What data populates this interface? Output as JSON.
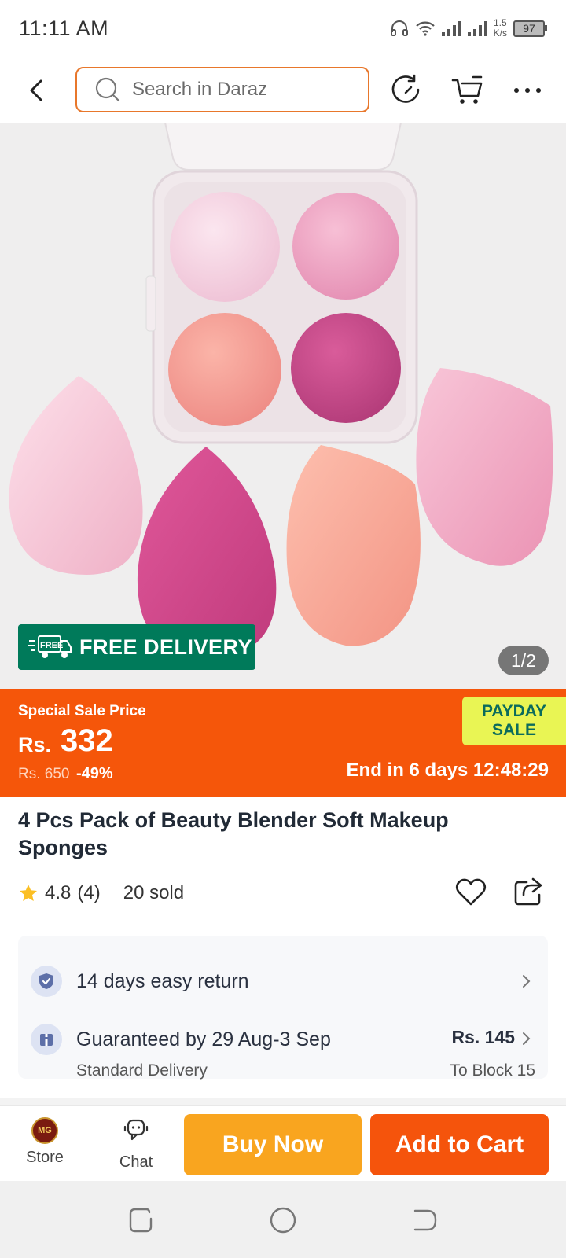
{
  "status_bar": {
    "time": "11:11 AM",
    "net_speed_value": "1.5",
    "net_speed_unit": "K/s",
    "battery": "97"
  },
  "header": {
    "search_placeholder": "Search in Daraz"
  },
  "gallery": {
    "free_delivery_label": "FREE DELIVERY",
    "free_truck_text": "FREE",
    "counter": "1/2"
  },
  "sale": {
    "label": "Special Sale Price",
    "currency": "Rs.",
    "price": "332",
    "original_price": "Rs. 650",
    "discount": "-49%",
    "campaign_line1": "PAYDAY",
    "campaign_line2": "SALE",
    "countdown": "End in 6 days 12:48:29",
    "colors": {
      "banner": "#f5560a",
      "campaign_bg": "#e9f554",
      "campaign_text": "#0b6b5c"
    }
  },
  "product": {
    "title": "4 Pcs Pack of Beauty Blender Soft Makeup Sponges",
    "rating": "4.8",
    "rating_count": "(4)",
    "sold": "20 sold"
  },
  "delivery": {
    "return_policy": "14 days easy return",
    "guarantee": "Guaranteed by 29 Aug-3 Sep",
    "method": "Standard Delivery",
    "fee": "Rs. 145",
    "destination": "To Block 15"
  },
  "actions": {
    "store_label": "Store",
    "store_logo_text": "MG",
    "chat_label": "Chat",
    "buy_now": "Buy Now",
    "add_to_cart": "Add to Cart",
    "colors": {
      "buy_now": "#f9a51f",
      "add_to_cart": "#f5540c"
    }
  },
  "icons": [
    "back-icon",
    "search-icon",
    "refresh-icon",
    "cart-icon",
    "more-icon",
    "star-icon",
    "heart-icon",
    "share-icon",
    "shield-check-icon",
    "parcel-icon",
    "chevron-right-icon",
    "chat-icon",
    "recents-icon",
    "home-icon",
    "nav-back-icon"
  ]
}
